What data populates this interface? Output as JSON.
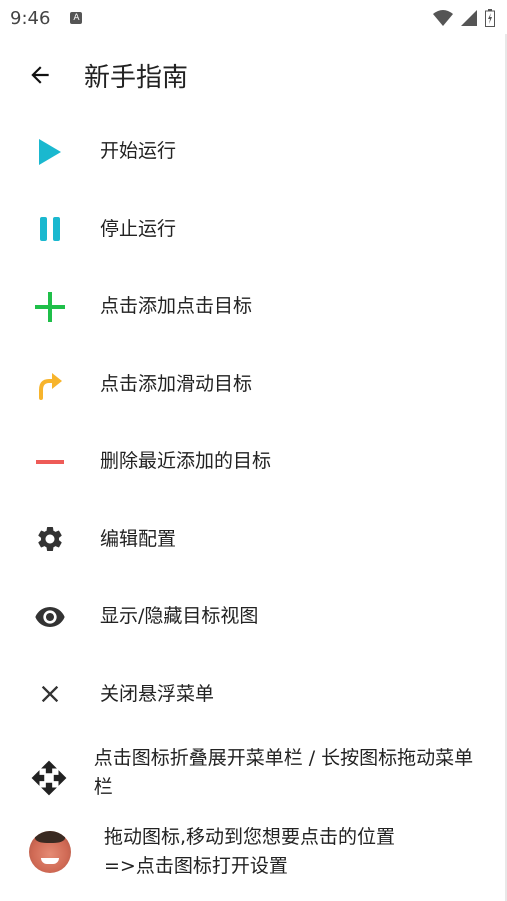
{
  "status_bar": {
    "time": "9:46",
    "notification_badge": "A"
  },
  "header": {
    "title": "新手指南"
  },
  "items": [
    {
      "label": "开始运行",
      "icon": "play-icon",
      "color": "#1ab8cf"
    },
    {
      "label": "停止运行",
      "icon": "pause-icon",
      "color": "#1ab8cf"
    },
    {
      "label": "点击添加点击目标",
      "icon": "plus-icon",
      "color": "#1fbf4a"
    },
    {
      "label": "点击添加滑动目标",
      "icon": "swipe-arrow-icon",
      "color": "#f7b42c"
    },
    {
      "label": "删除最近添加的目标",
      "icon": "minus-icon",
      "color": "#ee5b57"
    },
    {
      "label": "编辑配置",
      "icon": "gear-icon",
      "color": "#333333"
    },
    {
      "label": "显示/隐藏目标视图",
      "icon": "eye-icon",
      "color": "#333333"
    },
    {
      "label": "关闭悬浮菜单",
      "icon": "close-icon",
      "color": "#333333"
    },
    {
      "label": "点击图标折叠展开菜单栏 / 长按图标拖动菜单栏",
      "icon": "move-icon",
      "color": "#222222"
    },
    {
      "label": "拖动图标,移动到您想要点击的位置\n=>点击图标打开设置",
      "icon": "avatar-icon",
      "color": "#d06a55"
    }
  ]
}
